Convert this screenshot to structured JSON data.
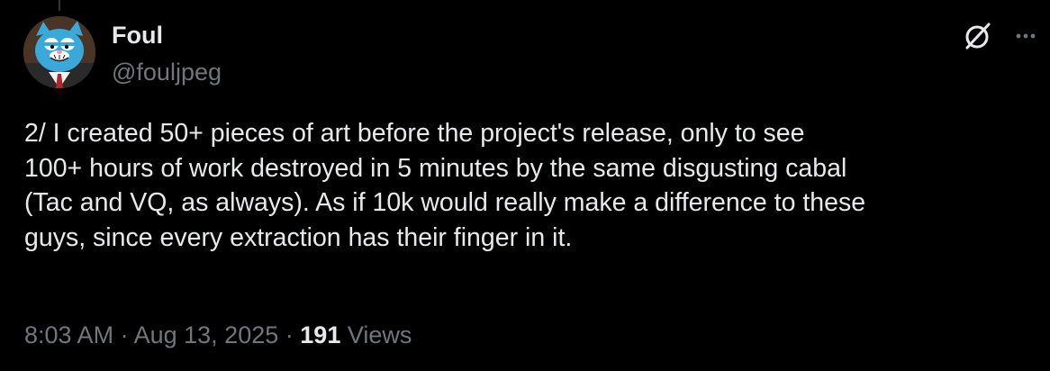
{
  "author": {
    "display_name": "Foul",
    "handle": "@fouljpeg",
    "avatar_icon": "avatar-cartoon-cat-icon"
  },
  "tweet": {
    "text": "2/ I created 50+ pieces of art before the project's release, only to see\n100+ hours of work destroyed in 5 minutes by the same disgusting cabal\n(Tac and VQ, as always). As if 10k would really make a difference to these\nguys, since every extraction has their finger in it."
  },
  "meta": {
    "time": "8:03 AM",
    "separator": "·",
    "date": "Aug 13, 2025",
    "views_count": "191",
    "views_label": "Views"
  },
  "actions": {
    "grok_icon": "grok-icon",
    "more_icon": "more-icon"
  },
  "colors": {
    "background": "#000000",
    "primary_text": "#e7e9ea",
    "secondary_text": "#71767b",
    "avatar_blue": "#3aa9d9"
  }
}
